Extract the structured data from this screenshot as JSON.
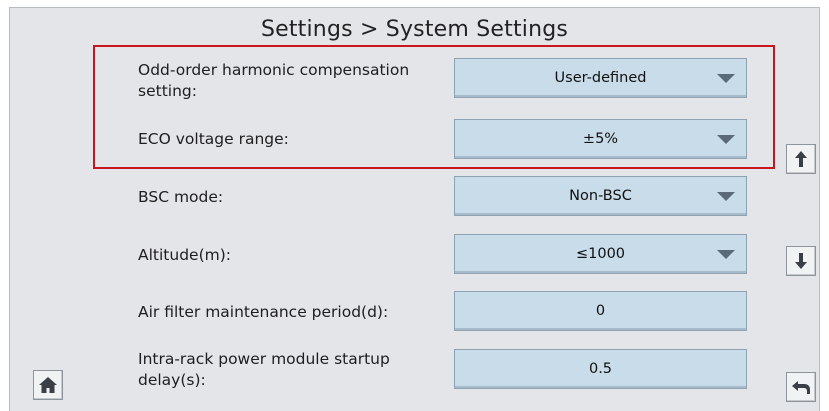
{
  "header": {
    "title": "Settings > System Settings"
  },
  "settings": [
    {
      "label": "Odd-order harmonic compensation setting:",
      "value": "User-defined",
      "type": "dropdown"
    },
    {
      "label": "ECO voltage range:",
      "value": "±5%",
      "type": "dropdown"
    },
    {
      "label": "BSC mode:",
      "value": "Non-BSC",
      "type": "dropdown"
    },
    {
      "label": "Altitude(m):",
      "value": "≤1000",
      "type": "dropdown"
    },
    {
      "label": "Air filter maintenance period(d):",
      "value": "0",
      "type": "input"
    },
    {
      "label": "Intra-rack power module startup delay(s):",
      "value": "0.5",
      "type": "input"
    }
  ],
  "icons": {
    "scroll_up": "up-arrow-icon",
    "scroll_down": "down-arrow-icon",
    "home": "home-icon",
    "back": "back-arrow-icon"
  },
  "colors": {
    "background": "#e3e5e9",
    "field_fill": "#c9dcea",
    "highlight_border": "#c8161d"
  }
}
